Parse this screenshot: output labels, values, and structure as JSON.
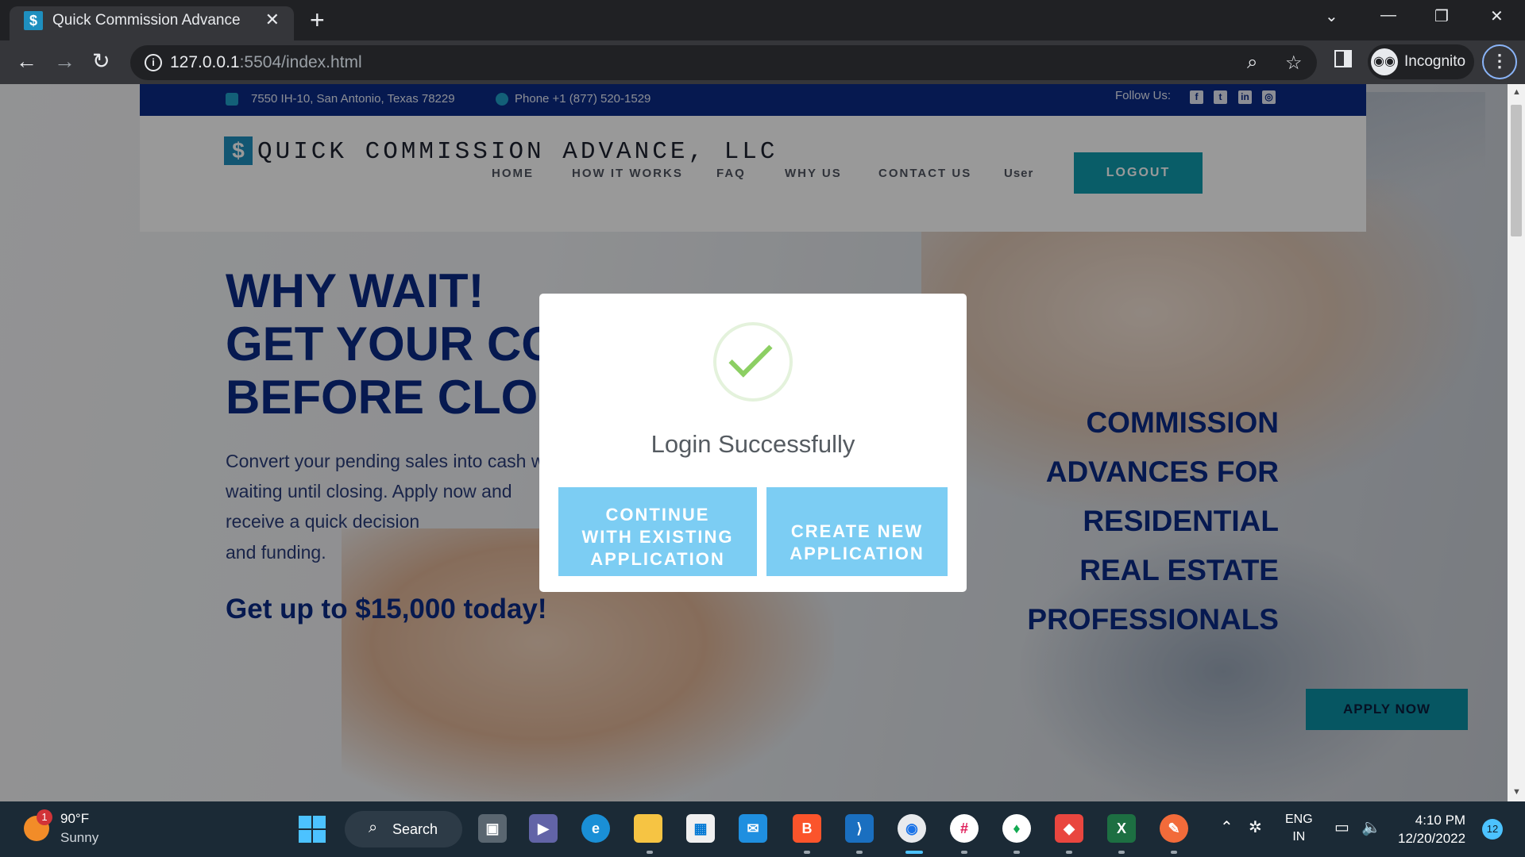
{
  "browser": {
    "tab_title": "Quick Commission Advance",
    "url_host": "127.0.0.1",
    "url_rest": ":5504/index.html",
    "profile_label": "Incognito"
  },
  "topbar": {
    "address": "7550 IH-10, San Antonio, Texas 78229",
    "phone": "Phone +1 (877) 520-1529",
    "follow_label": "Follow Us:",
    "social": [
      "facebook-icon",
      "twitter-icon",
      "linkedin-icon",
      "instagram-icon"
    ]
  },
  "header": {
    "logo_text": "QUICK COMMISSION ADVANCE, LLC",
    "nav": [
      "HOME",
      "HOW IT WORKS",
      "FAQ",
      "WHY US",
      "CONTACT US",
      "User"
    ],
    "logout_label": "LOGOUT"
  },
  "hero": {
    "headline": [
      "WHY WAIT!",
      "GET YOUR CO",
      "BEFORE CLOS"
    ],
    "paragraph": [
      "Convert your pending sales into cash wit",
      "waiting until closing.  Apply now and",
      "receive a quick decision",
      "and funding."
    ],
    "cta": "Get up to $15,000 today!",
    "right_heading": [
      "COMMISSION",
      "ADVANCES FOR",
      "RESIDENTIAL",
      "REAL ESTATE",
      "PROFESSIONALS"
    ],
    "apply_label": "APPLY NOW"
  },
  "modal": {
    "title": "Login Successfully",
    "continue_lines": [
      "CONTINUE",
      "WITH EXISTING",
      "APPLICATION"
    ],
    "create_lines": [
      "CREATE NEW",
      "APPLICATION"
    ],
    "accent_color": "#7ccdf3",
    "check_color": "#8ccf63"
  },
  "taskbar": {
    "weather_temp": "90°F",
    "weather_cond": "Sunny",
    "weather_badge": "1",
    "search_label": "Search",
    "lang_1": "ENG",
    "lang_2": "IN",
    "time": "4:10 PM",
    "date": "12/20/2022",
    "notification_count": "12"
  }
}
